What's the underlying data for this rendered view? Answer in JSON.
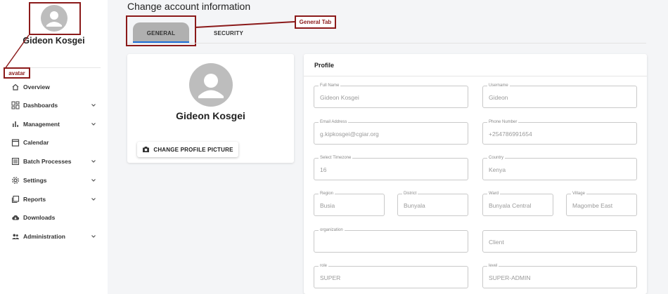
{
  "sidebar": {
    "user_name": "Gideon Kosgei",
    "items": [
      {
        "label": "Overview",
        "icon": "home-icon",
        "has_chevron": false
      },
      {
        "label": "Dashboards",
        "icon": "dashboard-grid-icon",
        "has_chevron": true
      },
      {
        "label": "Management",
        "icon": "bar-chart-icon",
        "has_chevron": true
      },
      {
        "label": "Calendar",
        "icon": "calendar-icon",
        "has_chevron": false
      },
      {
        "label": "Batch Processes",
        "icon": "list-alt-icon",
        "has_chevron": true
      },
      {
        "label": "Settings",
        "icon": "gear-icon",
        "has_chevron": true
      },
      {
        "label": "Reports",
        "icon": "library-books-icon",
        "has_chevron": true
      },
      {
        "label": "Downloads",
        "icon": "cloud-download-icon",
        "has_chevron": false
      },
      {
        "label": "Administration",
        "icon": "people-icon",
        "has_chevron": true
      }
    ]
  },
  "annotations": {
    "avatar_label": "avatar",
    "general_tab_label": "General Tab",
    "color": "#8b1a1a"
  },
  "page": {
    "title": "Change account information"
  },
  "tabs": [
    {
      "label": "GENERAL",
      "active": true
    },
    {
      "label": "SECURITY",
      "active": false
    }
  ],
  "profile_card": {
    "name": "Gideon Kosgei",
    "button_label": "CHANGE PROFILE PICTURE"
  },
  "profile_form": {
    "heading": "Profile",
    "fields": [
      {
        "label": "Full Name",
        "value": "Gideon Kosgei"
      },
      {
        "label": "Username",
        "value": "Gideon"
      },
      {
        "label": "Email Address",
        "value": "g.kipkosgei@cgiar.org"
      },
      {
        "label": "Phone Number",
        "value": "+254786991654"
      },
      {
        "label": "Select Timezone",
        "value": "16"
      },
      {
        "label": "Country",
        "value": "Kenya"
      },
      {
        "label": "Region",
        "value": "Busia"
      },
      {
        "label": "District",
        "value": "Bunyala"
      },
      {
        "label": "Ward",
        "value": "Bunyala Central"
      },
      {
        "label": "Village",
        "value": "Magombe East"
      },
      {
        "label": "organization",
        "value": ""
      },
      {
        "label": "",
        "value": "Client"
      },
      {
        "label": "role",
        "value": "SUPER"
      },
      {
        "label": "level",
        "value": "SUPER-ADMIN"
      }
    ]
  },
  "colors": {
    "accent": "#1e6fd9",
    "active_tab_bg": "#b0b0b0",
    "avatar_bg": "#bdbdbd"
  }
}
